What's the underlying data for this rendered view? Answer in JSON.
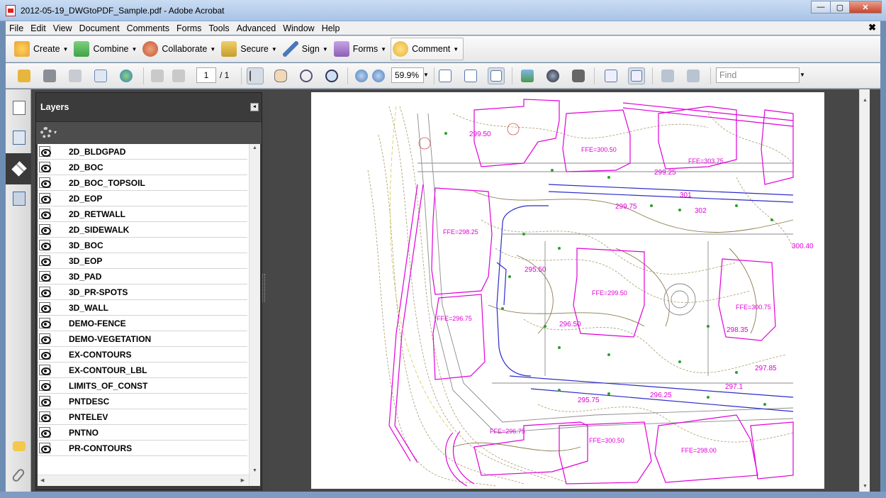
{
  "window": {
    "title": "2012-05-19_DWGtoPDF_Sample.pdf - Adobe Acrobat",
    "minimize": "—",
    "maximize": "▢",
    "close": "✕"
  },
  "menu": {
    "items": [
      "File",
      "Edit",
      "View",
      "Document",
      "Comments",
      "Forms",
      "Tools",
      "Advanced",
      "Window",
      "Help"
    ],
    "close": "✖"
  },
  "tasks": [
    {
      "label": "Create",
      "icon": "create-icon",
      "color": "#e8a235"
    },
    {
      "label": "Combine",
      "icon": "combine-icon",
      "color": "#3fa345"
    },
    {
      "label": "Collaborate",
      "icon": "collaborate-icon",
      "color": "#c0563a"
    },
    {
      "label": "Secure",
      "icon": "lock-icon",
      "color": "#c89c2a"
    },
    {
      "label": "Sign",
      "icon": "pen-icon",
      "color": "#4a78b8"
    },
    {
      "label": "Forms",
      "icon": "forms-icon",
      "color": "#8c5fb4"
    },
    {
      "label": "Comment",
      "icon": "comment-icon",
      "color": "#e5b335"
    }
  ],
  "toolbar": {
    "page_current": "1",
    "page_total": "/ 1",
    "zoom": "59.9%",
    "find_placeholder": "Find"
  },
  "sidebar": {
    "panel_title": "Layers",
    "collapse": "◂",
    "options_caret": "▾",
    "layers": [
      "2D_BLDGPAD",
      "2D_BOC",
      "2D_BOC_TOPSOIL",
      "2D_EOP",
      "2D_RETWALL",
      "2D_SIDEWALK",
      "3D_BOC",
      "3D_EOP",
      "3D_PAD",
      "3D_PR-SPOTS",
      "3D_WALL",
      "DEMO-FENCE",
      "DEMO-VEGETATION",
      "EX-CONTOURS",
      "EX-CONTOUR_LBL",
      "LIMITS_OF_CONST",
      "PNTDESC",
      "PNTELEV",
      "PNTNO",
      "PR-CONTOURS"
    ]
  },
  "drawing": {
    "labels": [
      "FFE=300.50",
      "FFE=303.75",
      "FFE=298.25",
      "FFE=299.50",
      "FFE=300.75",
      "FFE=296.75",
      "FFE=296.75",
      "FFE=298.00",
      "FFE=300.50",
      "299.50",
      "299.75",
      "299.25",
      "296.50",
      "295.50",
      "297.85",
      "298.35",
      "297.1",
      "296.25",
      "295.75",
      "300.40",
      "301",
      "302"
    ],
    "colors": {
      "magenta": "#e000d8",
      "blue": "#2c2cc8",
      "olive": "#9a8a5a",
      "gray": "#8a8a8a",
      "yellow": "#d4c84a",
      "green": "#2aa02a"
    }
  }
}
